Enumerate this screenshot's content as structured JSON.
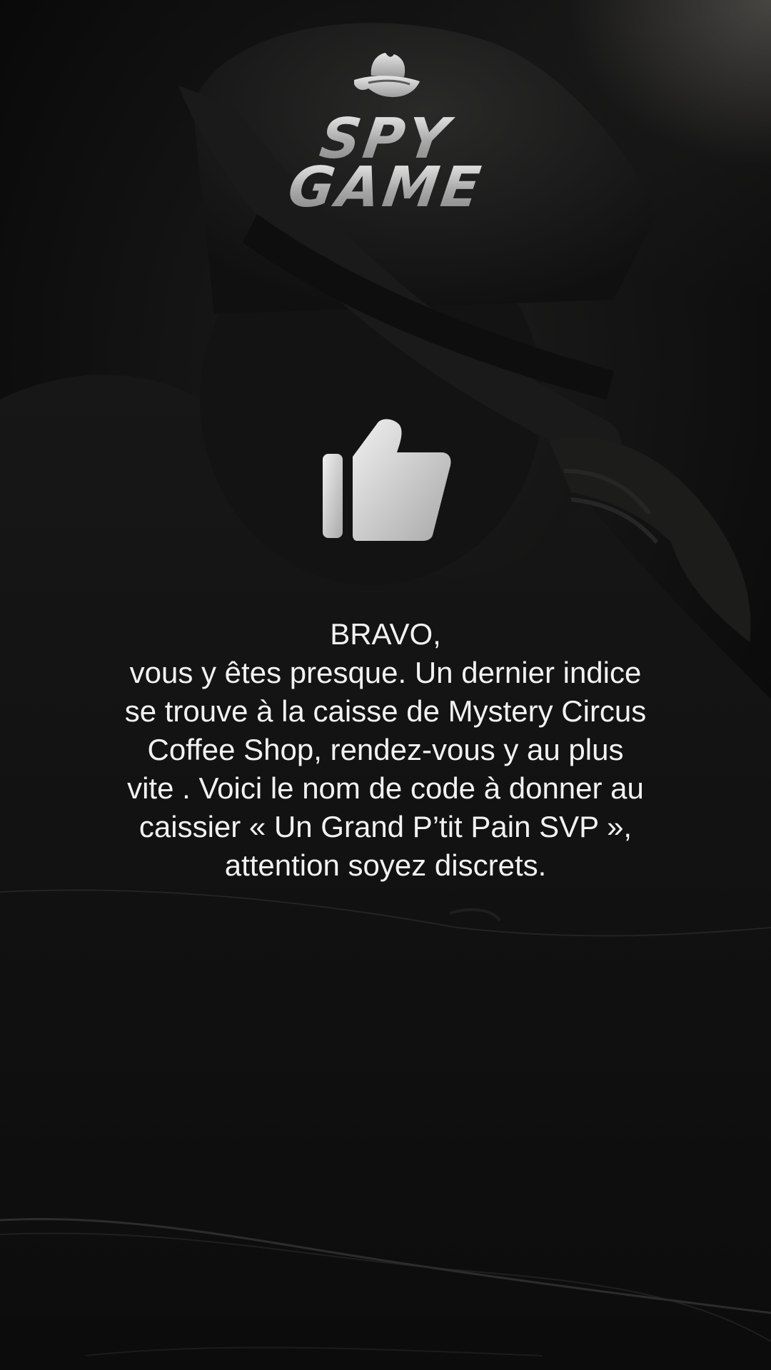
{
  "app": {
    "logo": {
      "line1": "SPY",
      "line2": "GAME"
    }
  },
  "icons": {
    "logo_hat": "spy-hat-icon",
    "feedback": "thumbs-up-icon"
  },
  "message": {
    "heading": "BRAVO,",
    "body": "vous y êtes presque. Un dernier indice\nse trouve à la caisse de Mystery Circus\nCoffee Shop, rendez-vous y au plus\nvite . Voici le nom de code à donner au\ncaissier « Un Grand P’tit Pain SVP »,\nattention soyez discrets."
  },
  "colors": {
    "background": "#0b0b0b",
    "text": "#f2f2f2",
    "logo": "#b9b9b9",
    "icon": "#d4d4d4"
  }
}
